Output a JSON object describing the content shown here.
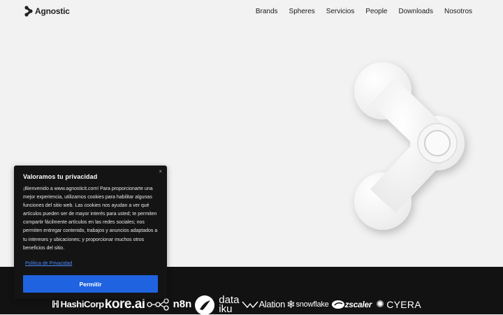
{
  "header": {
    "logo_text": "Agnostic",
    "logo_icon": "agnostic-logo-icon",
    "nav": [
      "Brands",
      "Spheres",
      "Servicios",
      "People",
      "Downloads",
      "Nosotros"
    ]
  },
  "hero": {
    "graphic_icon": "spinner-3d-logo-icon",
    "background_color": "#f2f2f2"
  },
  "partners": {
    "band_color": "#121212",
    "logos": {
      "hashicorp": "HashiCorp",
      "kore": "kore.ai",
      "n8n": "n8n",
      "dataiku_line1": "data",
      "dataiku_line2": "iku",
      "alation": "Alation",
      "snowflake": "snowflake",
      "zscaler": "zscaler",
      "cyera": "CYERA"
    }
  },
  "cookie_banner": {
    "title": "Valoramos tu privacidad",
    "body": "¡Bienvenido a www.agnosticit.com! Para proporcionarte una mejor experiencia, utilizamos cookies para habilitar algunas funciones del sitio web. Las cookies nos ayudan a ver qué artículos pueden ser de mayor interés para usted; te permiten compartir fácilmente artículos en las redes sociales; nos permiten entregar contenido, trabajos y anuncios adaptados a tu intereses y ubicaciones; y proporcionar muchos otros beneficios del sitio.",
    "link": "Política de Privacidad",
    "button": "Permitir",
    "close": "×",
    "accent_color": "#1f63e0"
  }
}
